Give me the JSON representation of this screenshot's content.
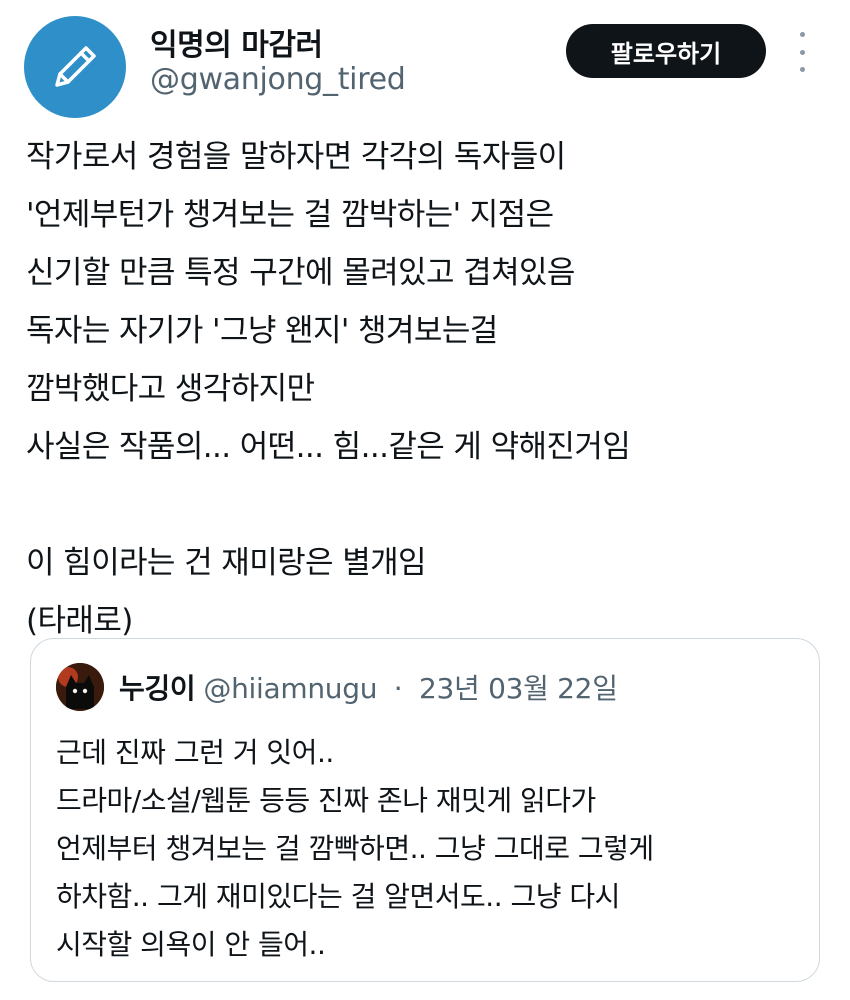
{
  "author": {
    "display_name": "익명의 마감러",
    "handle": "@gwanjong_tired",
    "avatar_icon": "pencil-icon",
    "avatar_color": "#2f8fc9"
  },
  "actions": {
    "follow_label": "팔로우하기",
    "more_icon": "more-vertical-icon"
  },
  "tweet": {
    "lines": [
      "작가로서 경험을 말하자면 각각의 독자들이",
      "'언제부턴가 챙겨보는 걸 깜박하는' 지점은",
      "신기할 만큼 특정 구간에 몰려있고 겹쳐있음",
      "독자는 자기가 '그냥 왠지' 챙겨보는걸",
      "깜박했다고 생각하지만",
      "사실은 작품의... 어떤... 힘...같은 게 약해진거임",
      "",
      "이 힘이라는 건 재미랑은 별개임",
      "(타래로)"
    ]
  },
  "quote": {
    "name": "누깅이",
    "handle": "@hiiamnugu",
    "separator": "·",
    "date": "23년 03월 22일",
    "lines": [
      "근데 진짜 그런 거 잇어..",
      "드라마/소설/웹툰 등등 진짜 존나 재밋게 읽다가",
      "언제부터 챙겨보는 걸 깜빡하면.. 그냥 그대로 그렇게",
      "하차함.. 그게 재미있다는 걸 알면서도.. 그냥 다시",
      "시작할 의욕이 안 들어.."
    ]
  },
  "colors": {
    "text": "#0f1419",
    "muted": "#536471",
    "button_bg": "#0f1419",
    "border": "#cfd9de"
  }
}
